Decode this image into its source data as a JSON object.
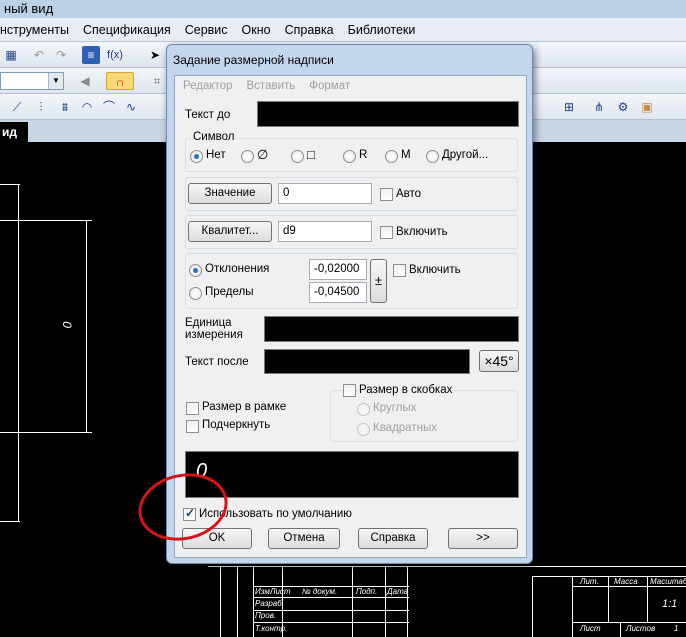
{
  "app": {
    "title_fragment": "ный вид",
    "menu": [
      "нструменты",
      "Спецификация",
      "Сервис",
      "Окно",
      "Справка",
      "Библиотеки"
    ],
    "menu_underline": [
      "",
      "С",
      "С",
      "О",
      "С",
      "Б"
    ],
    "doc_tab": "ид",
    "fx": "f(x)"
  },
  "drawing": {
    "dimension_text": "0",
    "title_block": {
      "izm": "Изм.",
      "list": "Лист",
      "doc_no": "№ докум.",
      "podp": "Подп.",
      "data": "Дата",
      "razrab": "Разраб.",
      "prov": "Пров.",
      "tkontr": "Т.контр.",
      "lit": "Лит.",
      "massa": "Масса",
      "masshtab": "Масштаб",
      "scale_value": "1:1",
      "list_bottom": "Лист",
      "listov": "Листов",
      "listov_value": "1"
    }
  },
  "dialog": {
    "title": "Задание размерной надписи",
    "menu": [
      "Редактор",
      "Вставить",
      "Формат"
    ],
    "text_before_label": "Текст до",
    "symbol_group": "Символ",
    "symbol_options": [
      {
        "label": "Нет",
        "selected": true
      },
      {
        "label": "∅",
        "selected": false
      },
      {
        "label": "□",
        "selected": false
      },
      {
        "label": "R",
        "selected": false
      },
      {
        "label": "M",
        "selected": false
      },
      {
        "label": "Другой...",
        "selected": false
      }
    ],
    "value_button": "Значение",
    "value_field": "0",
    "auto_label": "Авто",
    "kvalitet_button": "Квалитет...",
    "kvalitet_field": "d9",
    "include_label_1": "Включить",
    "deviations_label": "Отклонения",
    "limits_label": "Пределы",
    "upper_dev": "-0,02000",
    "lower_dev": "-0,04500",
    "plusminus": "±",
    "include_label_2": "Включить",
    "units_label_1": "Единица",
    "units_label_2": "измерения",
    "text_after_label": "Текст после",
    "x45_button": "×45°",
    "brackets_label": "Размер в скобках",
    "round_label": "Круглых",
    "square_label": "Квадратных",
    "frame_label": "Размер в рамке",
    "underline_label": "Подчеркнуть",
    "preview_text": "0",
    "use_default_label": "Использовать по умолчанию",
    "use_default_checked": true,
    "ok_button": "OK",
    "cancel_button": "Отмена",
    "help_button": "Справка",
    "more_button": ">>"
  },
  "colors": {
    "annotation_circle": "#d8121b",
    "drawing_bg": "#000000",
    "radio_selected": "#2a6fc4"
  }
}
